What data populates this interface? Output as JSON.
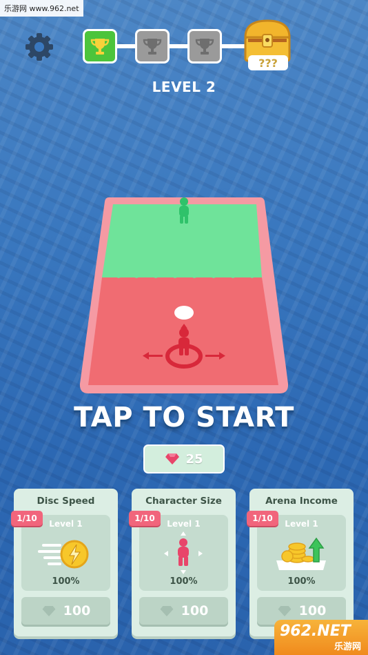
{
  "watermark": "乐游网 www.962.net",
  "progress": {
    "level_label": "LEVEL 2",
    "completed_stages": 1,
    "total_stages": 3,
    "chest_keys": "???"
  },
  "start_prompt": "TAP TO START",
  "gems": {
    "count": "25"
  },
  "upgrades": [
    {
      "title": "Disc Speed",
      "badge": "1/10",
      "level": "Level 1",
      "percent": "100%",
      "cost": "100"
    },
    {
      "title": "Character Size",
      "badge": "1/10",
      "level": "Level 1",
      "percent": "100%",
      "cost": "100"
    },
    {
      "title": "Arena Income",
      "badge": "1/10",
      "level": "Level 1",
      "percent": "100%",
      "cost": "100"
    }
  ],
  "brand": {
    "logo": "962.NET",
    "name": "乐游网"
  },
  "colors": {
    "field_green": "#6fe39a",
    "field_red": "#f06c72",
    "arena_border": "#f59aa3",
    "gem_pink": "#e8456a",
    "coin_yellow": "#f7c72a"
  }
}
